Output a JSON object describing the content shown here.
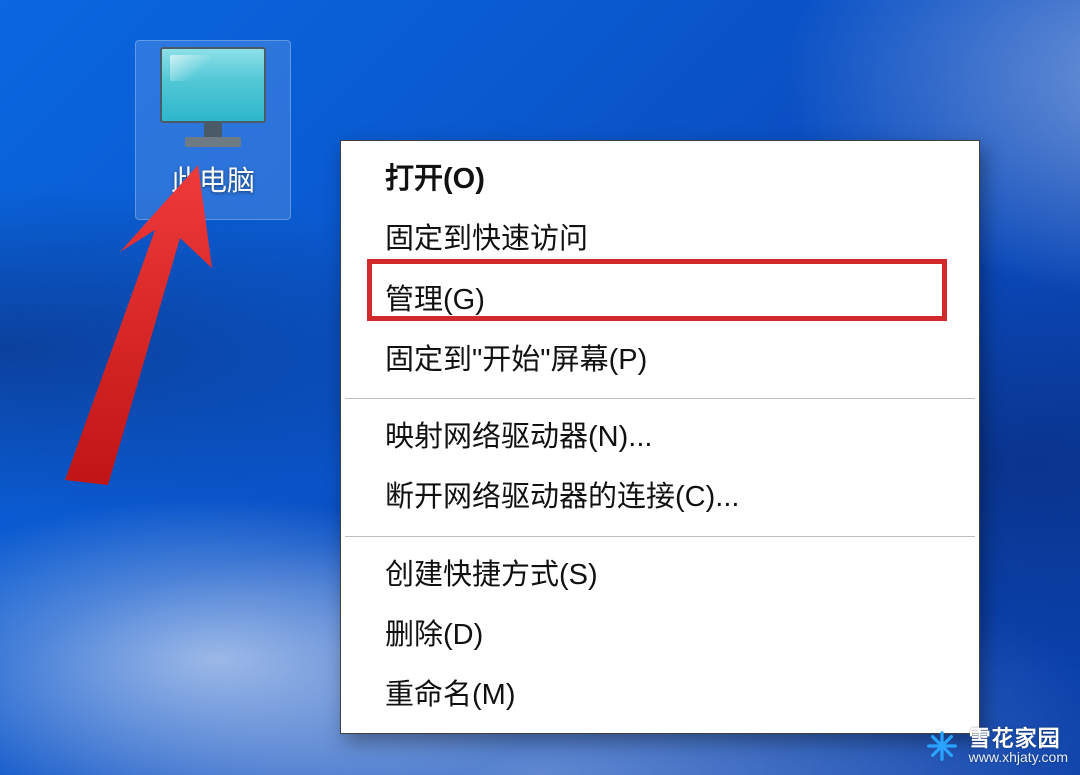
{
  "desktop": {
    "icon_label": "此电脑"
  },
  "context_menu": {
    "items": [
      "打开(O)",
      "固定到快速访问",
      "管理(G)",
      "固定到\"开始\"屏幕(P)",
      "映射网络驱动器(N)...",
      "断开网络驱动器的连接(C)...",
      "创建快捷方式(S)",
      "删除(D)",
      "重命名(M)"
    ],
    "highlighted_index": 2
  },
  "watermark": {
    "brand": "雪花家园",
    "url": "www.xhjaty.com"
  },
  "colors": {
    "highlight": "#d02a2a"
  }
}
